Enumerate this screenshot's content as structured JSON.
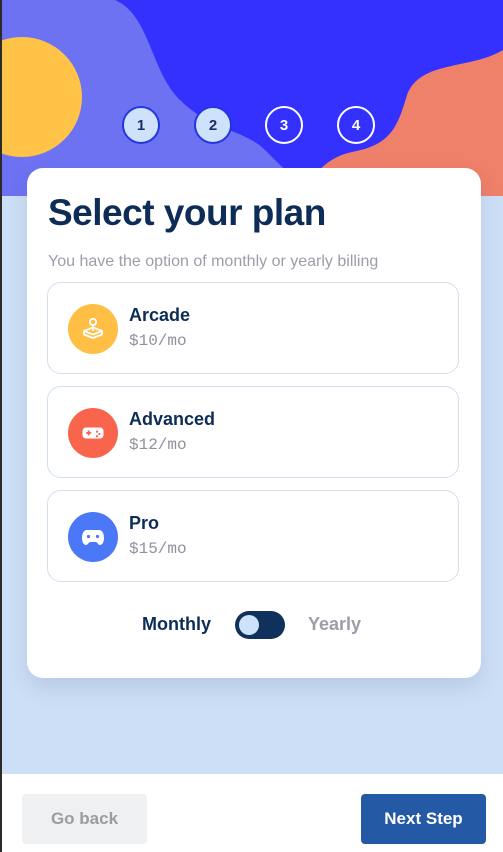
{
  "steps": [
    "1",
    "2",
    "3",
    "4"
  ],
  "card": {
    "title": "Select your plan",
    "subtitle": "You have the option of monthly or yearly billing"
  },
  "plans": [
    {
      "name": "Arcade",
      "price": "$10/mo",
      "icon": "joystick-icon",
      "color": "#ffbf45"
    },
    {
      "name": "Advanced",
      "price": "$12/mo",
      "icon": "gamepad-icon",
      "color": "#f9654c"
    },
    {
      "name": "Pro",
      "price": "$15/mo",
      "icon": "controller-icon",
      "color": "#4a78f7"
    }
  ],
  "billing": {
    "monthly": "Monthly",
    "yearly": "Yearly"
  },
  "footer": {
    "back": "Go back",
    "next": "Next Step"
  },
  "colors": {
    "accent": "#2459a6",
    "title": "#0d2c56",
    "hero_blue": "#3431ff",
    "hero_orange": "#ef806a",
    "hero_yellow": "#ffc347",
    "background": "#cddff6"
  }
}
